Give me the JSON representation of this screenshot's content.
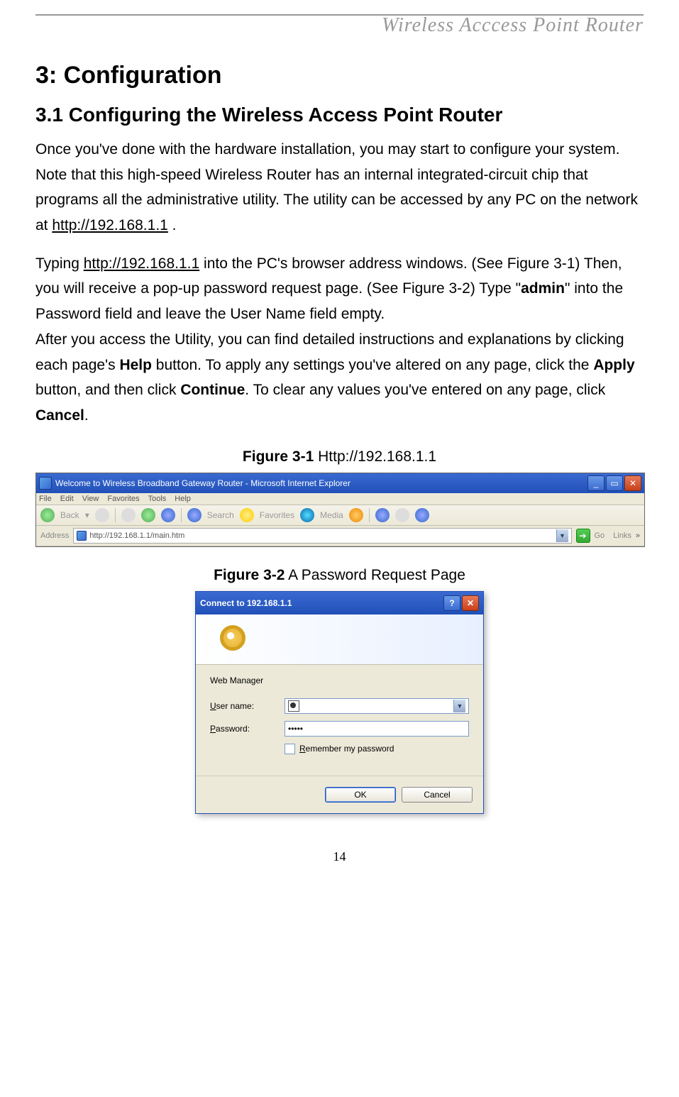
{
  "header": {
    "running_title": "Wireless  Acccess  Point  Router"
  },
  "section": {
    "h1": "3: Configuration",
    "h2": "3.1 Configuring the Wireless Access Point Router",
    "para1_a": "Once you've done with the hardware installation, you may start to configure your system. Note that this high-speed Wireless Router has an internal integrated-circuit chip that programs all the administrative utility. The utility can be accessed by any PC on the network at ",
    "url1": "http://192.168.1.1",
    "para1_b": " .",
    "para2_a": "Typing ",
    "url2": "http://192.168.1.1",
    "para2_b": " into the PC's browser address windows. (See Figure 3-1) Then, you will receive a pop-up password request page. (See Figure 3-2) Type \"",
    "admin": "admin",
    "para2_c": "\" into the Password field and leave the User Name field empty.",
    "para3_a": "After you access the Utility, you can find detailed instructions and explanations by clicking each page's ",
    "help": "Help",
    "para3_b": " button. To apply any settings you've altered on any page, click the ",
    "apply": "Apply",
    "para3_c": " button, and then click ",
    "cont": "Continue",
    "para3_d": ". To clear any values you've entered on any page, click ",
    "cancel": "Cancel",
    "para3_e": "."
  },
  "figure1": {
    "caption_bold": "Figure 3-1",
    "caption_rest": " Http://192.168.1.1",
    "ie": {
      "title": "Welcome to Wireless Broadband Gateway Router - Microsoft Internet Explorer",
      "menu": {
        "file": "File",
        "edit": "Edit",
        "view": "View",
        "favorites": "Favorites",
        "tools": "Tools",
        "help": "Help"
      },
      "toolbar": {
        "back": "Back",
        "search": "Search",
        "favorites": "Favorites",
        "media": "Media"
      },
      "addr_label": "Address",
      "addr_value": "http://192.168.1.1/main.htm",
      "go": "Go",
      "links": "Links"
    }
  },
  "figure2": {
    "caption_bold": "Figure 3-2",
    "caption_rest": " A Password Request Page",
    "dialog": {
      "title": "Connect to 192.168.1.1",
      "realm": "Web Manager",
      "user_label": "User name:",
      "user_value": "",
      "pass_label": "Password:",
      "pass_value": "•••••",
      "remember": "Remember my password",
      "ok": "OK",
      "cancel": "Cancel"
    }
  },
  "page_number": "14"
}
